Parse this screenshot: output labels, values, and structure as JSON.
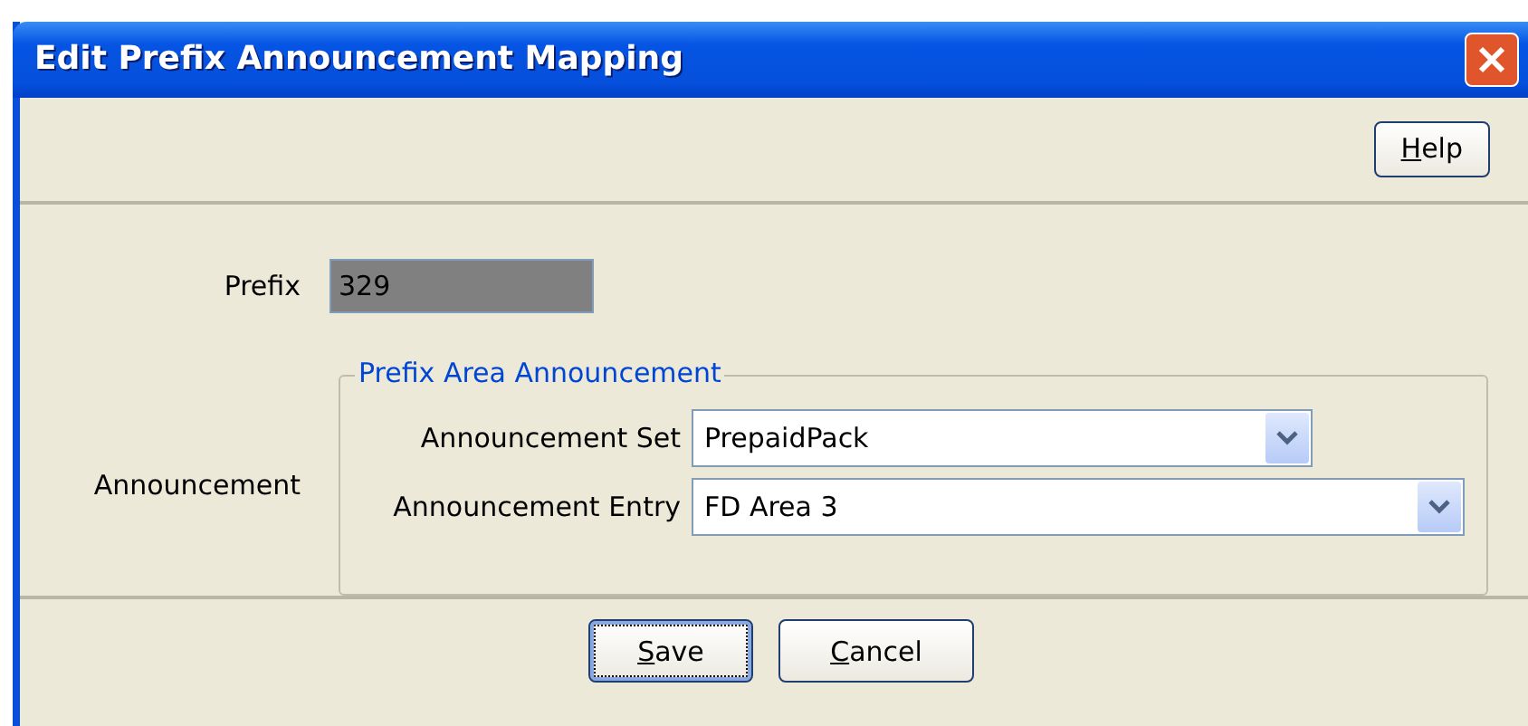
{
  "window": {
    "title": "Edit Prefix Announcement Mapping"
  },
  "toolbar": {
    "buttons": [
      {
        "label": "Help",
        "mnemonic": true,
        "focused": false
      }
    ]
  },
  "prefix": {
    "label": "Prefix",
    "value": "329",
    "disabled": true
  },
  "announcement": {
    "label": "Announcement",
    "group_title": "Prefix Area Announcement",
    "fields": [
      {
        "label": "Announcement Set",
        "value": "PrepaidPack",
        "wide": false
      },
      {
        "label": "Announcement Entry",
        "value": "FD Area 3",
        "wide": true
      }
    ]
  },
  "footer": {
    "buttons": [
      {
        "label": "Save",
        "mnemonic": true,
        "focused": true
      },
      {
        "label": "Cancel",
        "mnemonic": true,
        "focused": false
      }
    ]
  }
}
